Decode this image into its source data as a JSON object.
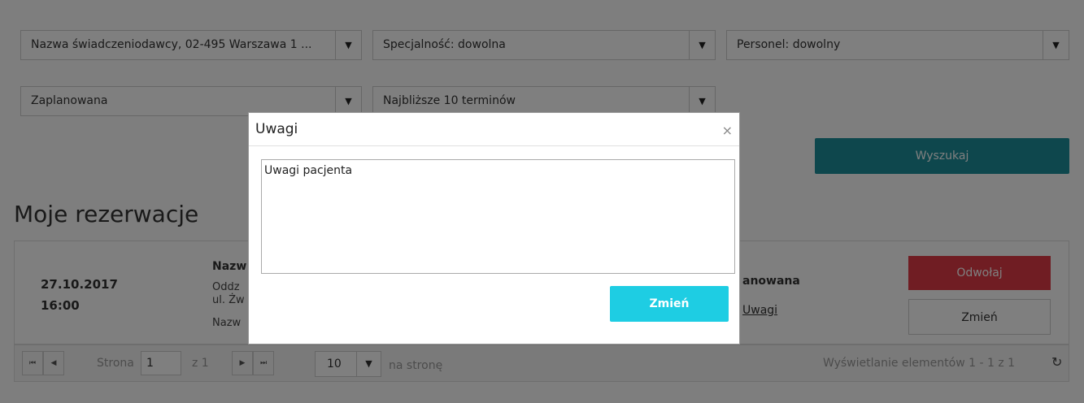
{
  "filters": {
    "provider": "Nazwa świadczeniodawcy, 02-495 Warszawa 1 ...",
    "specialty": "Specjalność: dowolna",
    "staff": "Personel: dowolny",
    "status": "Zaplanowana",
    "range": "Najbliższe 10 terminów",
    "search_label": "Wyszukaj"
  },
  "section_title": "Moje rezerwacje",
  "reservation": {
    "date": "27.10.2017",
    "time": "16:00",
    "provider_name_partial": "Nazw",
    "dept_partial": "Oddz",
    "street_partial": "ul. Żw",
    "name2_partial": "Nazw",
    "status_partial": "anowana",
    "notes_link": "Uwagi",
    "cancel_label": "Odwołaj",
    "change_label": "Zmień"
  },
  "pager": {
    "first_icon": "first-page-icon",
    "prev_icon": "prev-page-icon",
    "next_icon": "next-page-icon",
    "last_icon": "last-page-icon",
    "page_label": "Strona",
    "page_value": "1",
    "of_label": "z 1",
    "page_size": "10",
    "per_page_label": "na stronę",
    "summary": "Wyświetlanie elementów 1 - 1 z 1",
    "refresh_icon": "refresh-icon"
  },
  "modal": {
    "title": "Uwagi",
    "close_icon": "close-icon",
    "textarea_value": "Uwagi pacjenta",
    "submit_label": "Zmień"
  },
  "colors": {
    "accent_teal": "#1d8f9b",
    "accent_cyan": "#1ecde3",
    "danger": "#e03a46"
  }
}
